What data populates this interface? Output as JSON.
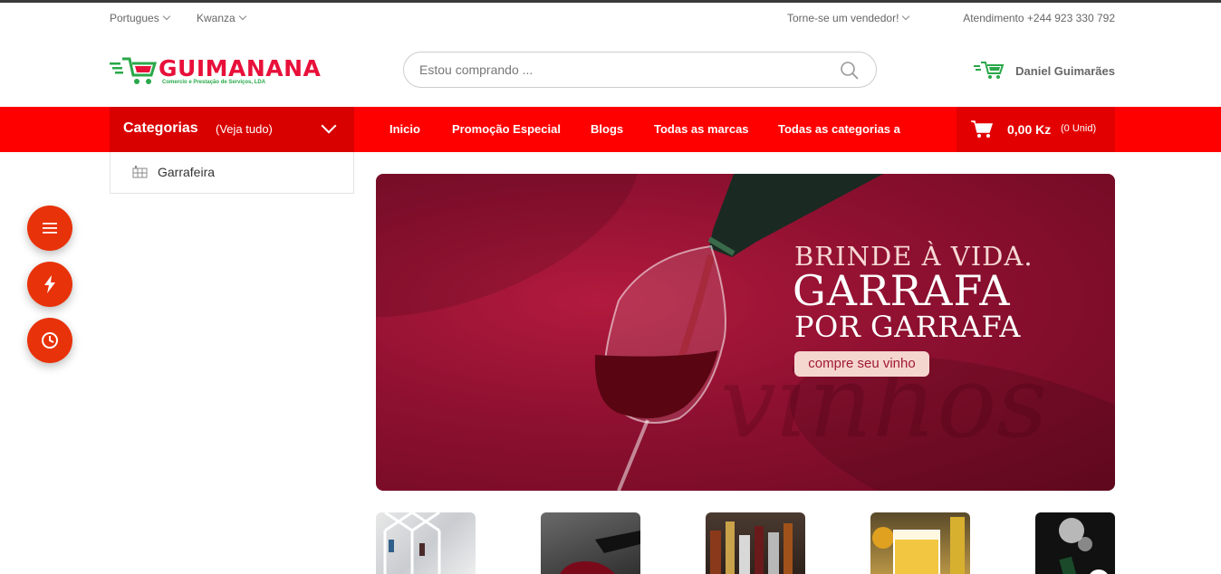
{
  "topbar": {
    "language": "Portugues",
    "currency": "Kwanza",
    "seller_link": "Torne-se um vendedor!",
    "support": "Atendimento +244 923 330 792"
  },
  "logo": {
    "name": "GUIMANANA",
    "tagline": "Comercio e Prestação de Serviços, LDA"
  },
  "search": {
    "placeholder": "Estou comprando ..."
  },
  "user": {
    "name": "Daniel Guimarães"
  },
  "categories": {
    "title": "Categorias",
    "see_all": "(Veja tudo)",
    "items": [
      {
        "label": "Garrafeira"
      }
    ]
  },
  "nav": {
    "items": [
      {
        "label": "Inicio"
      },
      {
        "label": "Promoção Especial"
      },
      {
        "label": "Blogs"
      },
      {
        "label": "Todas as marcas"
      },
      {
        "label": "Todas as categorias a"
      }
    ]
  },
  "cart": {
    "total": "0,00 Kz",
    "units": "(0 Unid)"
  },
  "banner": {
    "line1": "BRINDE À VIDA.",
    "line2": "GARRAFA",
    "line3": "POR GARRAFA",
    "button": "compre seu vinho",
    "script_text": "vinhos"
  },
  "colors": {
    "primary_red": "#ff0000",
    "category_red": "#d90000",
    "fab_orange": "#e8320a",
    "banner_wine": "#8e1030",
    "logo_green": "#2aa84a"
  },
  "floating_buttons": [
    {
      "icon": "menu-icon"
    },
    {
      "icon": "flash-icon"
    },
    {
      "icon": "clock-icon"
    }
  ],
  "thumbnails": [
    {
      "icon": "wine-rack-image"
    },
    {
      "icon": "red-wine-image"
    },
    {
      "icon": "spirits-bottles-image"
    },
    {
      "icon": "beer-glass-image"
    },
    {
      "icon": "champagne-image"
    }
  ]
}
